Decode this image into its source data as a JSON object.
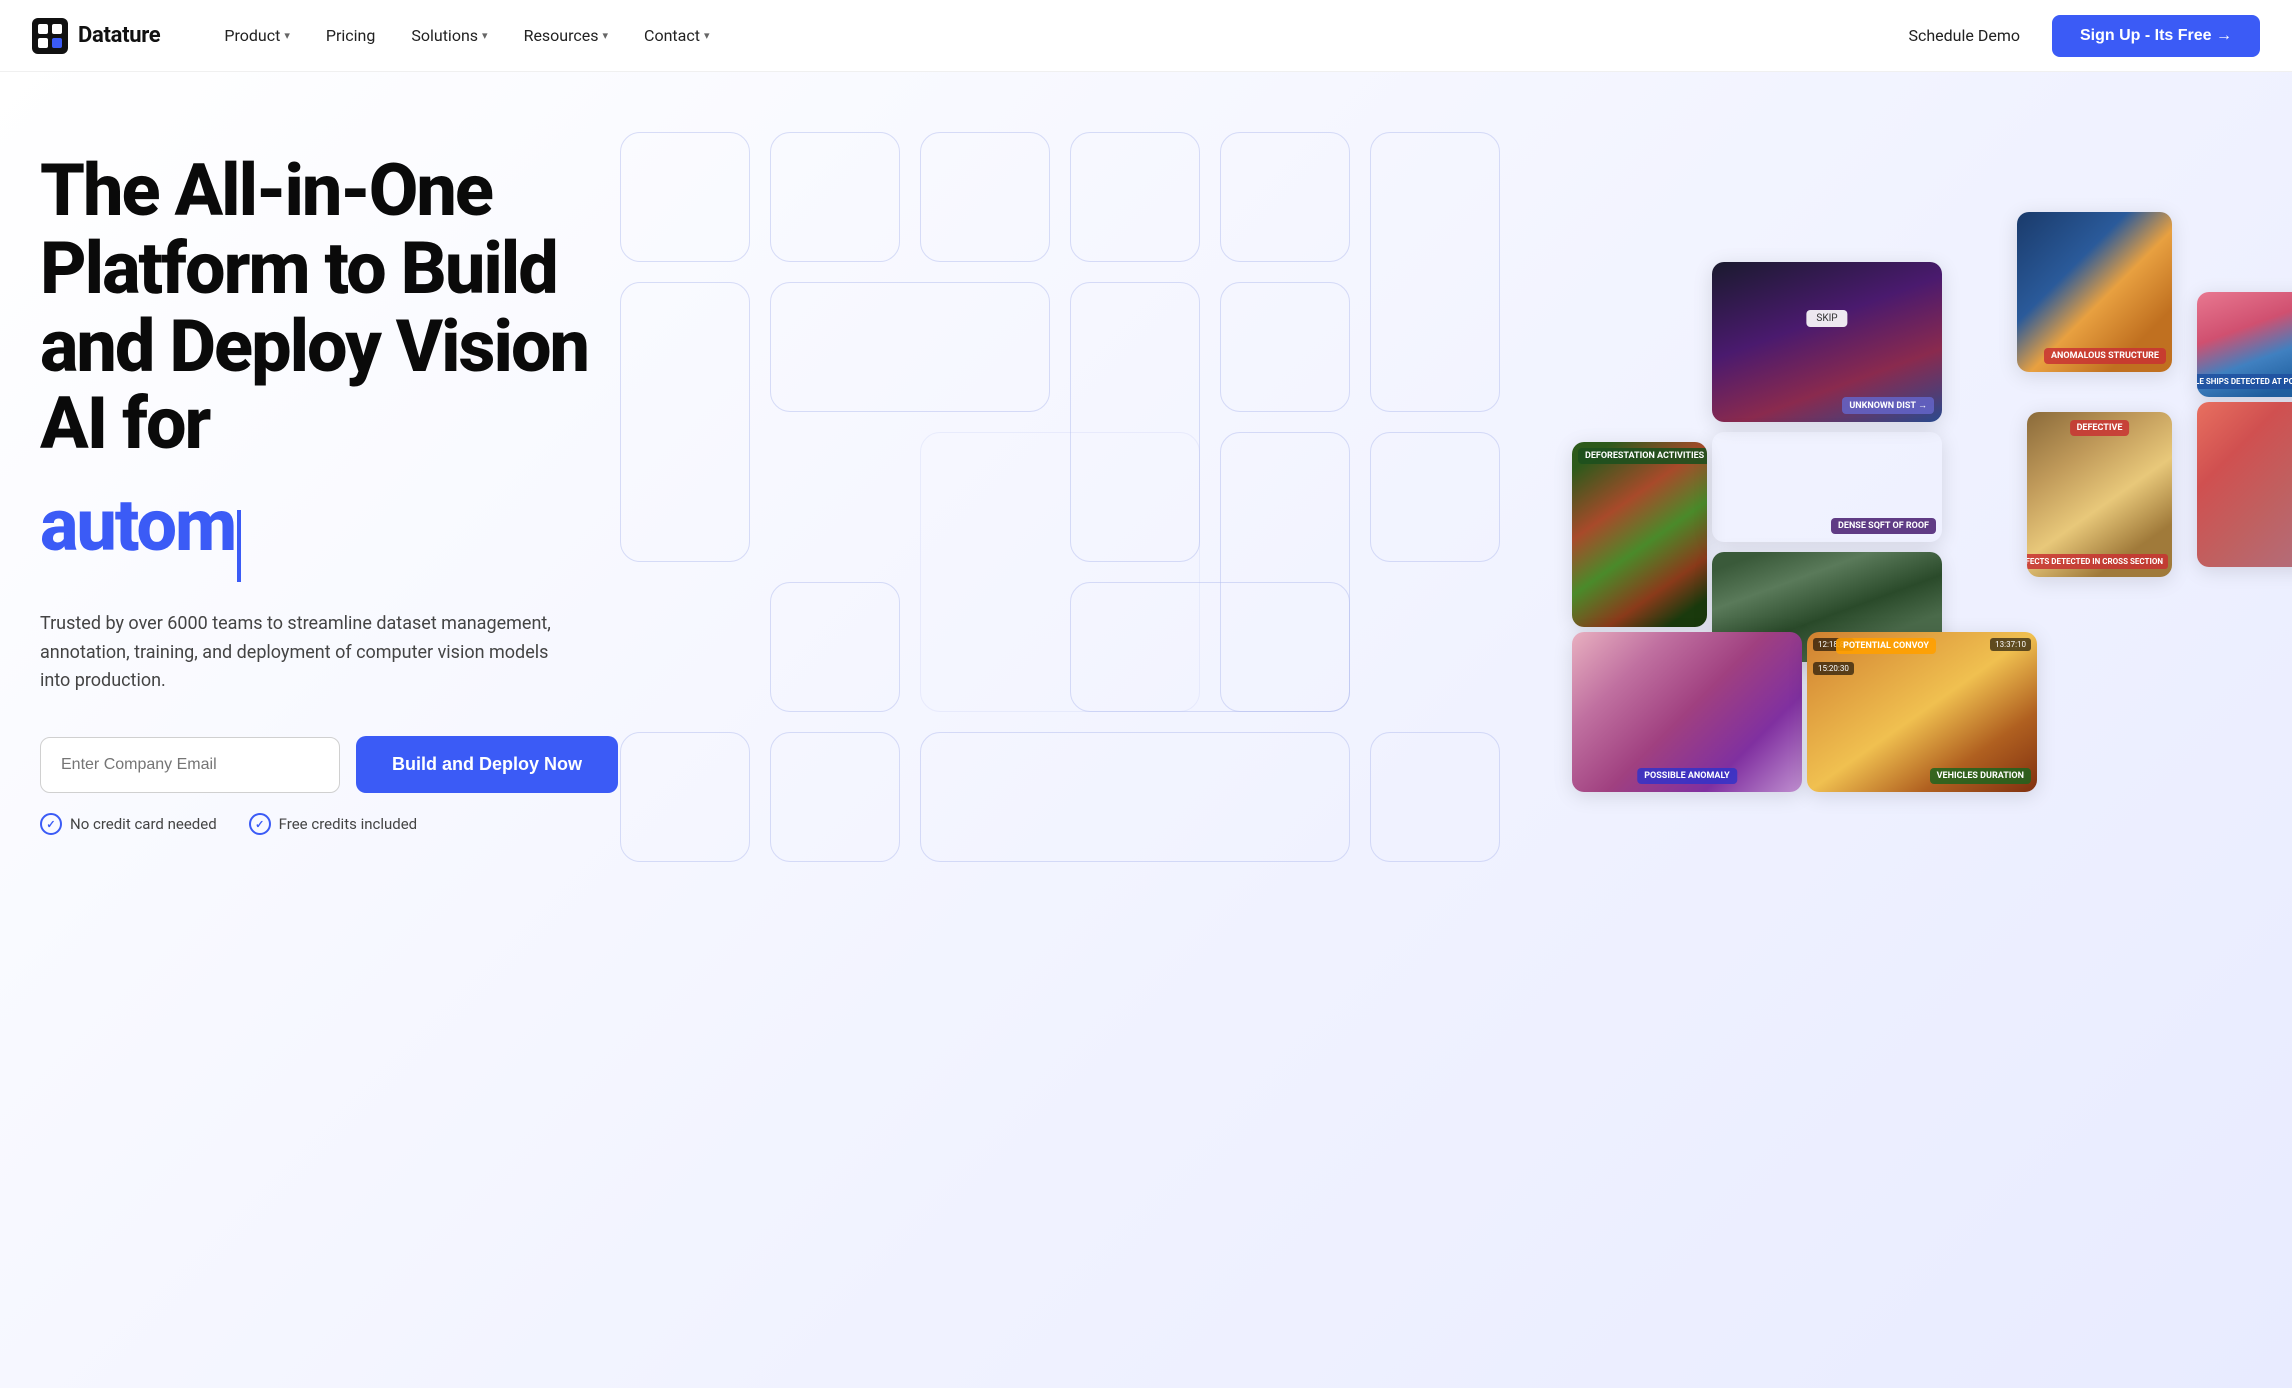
{
  "nav": {
    "logo_text": "Datature",
    "items": [
      {
        "label": "Product",
        "has_dropdown": true
      },
      {
        "label": "Pricing",
        "has_dropdown": false
      },
      {
        "label": "Solutions",
        "has_dropdown": true
      },
      {
        "label": "Resources",
        "has_dropdown": true
      },
      {
        "label": "Contact",
        "has_dropdown": true
      }
    ],
    "schedule_demo": "Schedule Demo",
    "signup_label": "Sign Up - Its Free →"
  },
  "hero": {
    "title_line1": "The All-in-One",
    "title_line2": "Platform to Build",
    "title_line3": "and Deploy Vision",
    "title_line4": "AI for",
    "typed_text": "autom|",
    "subtitle": "Trusted by over 6000 teams to streamline dataset management, annotation, training, and deployment of computer vision models into production.",
    "email_placeholder": "Enter Company Email",
    "cta_label": "Build and Deploy Now",
    "badge1": "No credit card needed",
    "badge2": "Free credits included"
  },
  "image_cards": [
    {
      "id": "satellite-anomaly",
      "label": "",
      "position": "top-center-large"
    },
    {
      "id": "structure",
      "label": "ANOMALOUS STRUCTURE",
      "label_color": "red"
    },
    {
      "id": "ships",
      "label": "MULTIPLE SHIPS DETECTED AT PORT C",
      "label_color": "blue"
    },
    {
      "id": "deforestation",
      "label": "DEFORESTATION ACTIVITIES",
      "label_color": "green"
    },
    {
      "id": "roof",
      "label": "DENSE SQFT OF ROOF",
      "label_color": "purple"
    },
    {
      "id": "convoy",
      "label": "POTENTIAL CONVOY",
      "label_color": "orange"
    },
    {
      "id": "defective",
      "label": "DEFECTS DETECTED IN CROSS SECTION",
      "label_color": "red"
    },
    {
      "id": "cell-anomaly",
      "label": "POSSIBLE ANOMALY",
      "label_color": "blue"
    },
    {
      "id": "vehicles",
      "label": "VEHICLES DURATION",
      "label_color": "green"
    }
  ]
}
